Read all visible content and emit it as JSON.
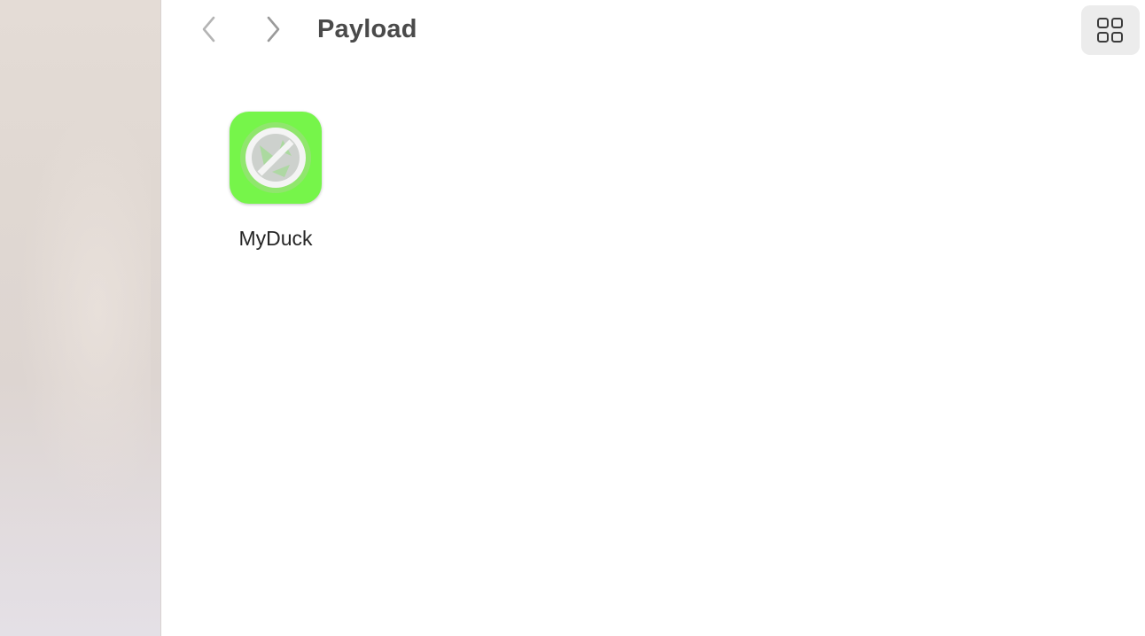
{
  "window": {
    "title": "Payload"
  },
  "toolbar": {
    "back_icon": "chevron-left-icon",
    "forward_icon": "chevron-right-icon",
    "view_toggle_icon": "grid-view-icon"
  },
  "files": [
    {
      "name": "MyDuck",
      "icon": "prohibited-app-icon",
      "icon_color": "#76f54a"
    }
  ],
  "colors": {
    "title": "#4a4a4a",
    "nav_disabled": "#b4b4b4",
    "nav_enabled": "#9a9a9a",
    "toggle_bg": "#ececec"
  }
}
